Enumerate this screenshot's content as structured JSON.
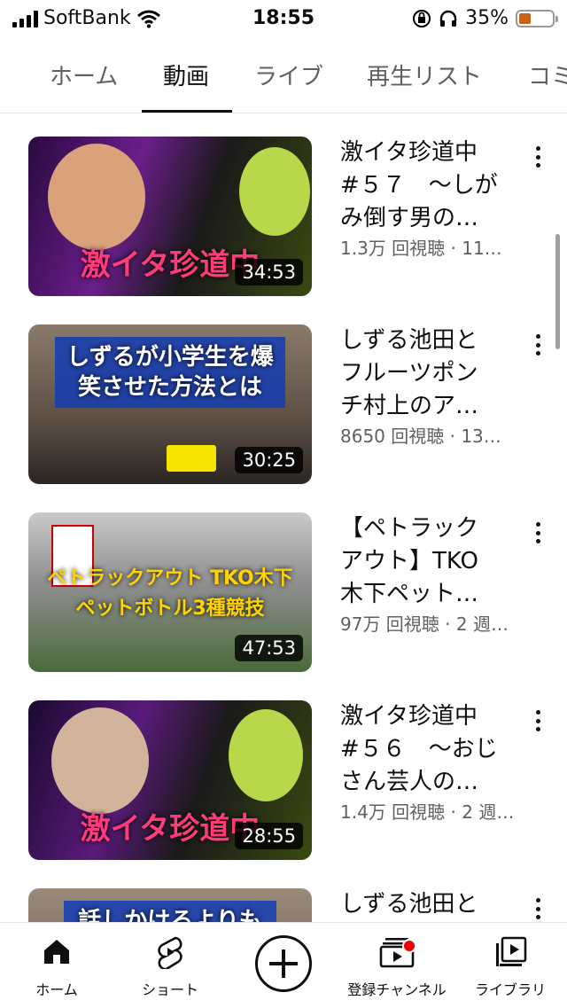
{
  "status": {
    "carrier": "SoftBank",
    "time": "18:55",
    "battery": "35%",
    "battery_level": 0.35
  },
  "tabs": [
    {
      "label": "ホーム",
      "active": false
    },
    {
      "label": "動画",
      "active": true
    },
    {
      "label": "ライブ",
      "active": false
    },
    {
      "label": "再生リスト",
      "active": false
    },
    {
      "label": "コミ",
      "active": false
    }
  ],
  "videos": [
    {
      "title": "激イタ珍道中\n#５７　〜しが\nみ倒す男の…",
      "meta": "1.3万 回視聴 · 11…",
      "duration": "34:53",
      "thumb_text": "激イタ珍道中"
    },
    {
      "title": "しずる池田と\nフルーツポン\nチ村上のア…",
      "meta": "8650 回視聴 · 13…",
      "duration": "30:25",
      "thumb_text": "しずるが小学生を爆笑させた方法とは"
    },
    {
      "title": "【ペトラック\nアウト】TKO\n木下ペット…",
      "meta": "97万 回視聴 · 2 週…",
      "duration": "47:53",
      "thumb_text": "ペトラックアウト TKO木下ペットボトル3種競技"
    },
    {
      "title": "激イタ珍道中\n#５６　〜おじ\nさん芸人の…",
      "meta": "1.4万 回視聴 · 2 週…",
      "duration": "28:55",
      "thumb_text": "激イタ珍道中"
    },
    {
      "title": "しずる池田と",
      "meta": "",
      "duration": "",
      "thumb_text": "話しかけるよりも"
    }
  ],
  "bottom_nav": [
    {
      "label": "ホーム",
      "icon": "home-icon"
    },
    {
      "label": "ショート",
      "icon": "shorts-icon"
    },
    {
      "label": "",
      "icon": "create-icon"
    },
    {
      "label": "登録チャンネル",
      "icon": "subscriptions-icon"
    },
    {
      "label": "ライブラリ",
      "icon": "library-icon"
    }
  ]
}
